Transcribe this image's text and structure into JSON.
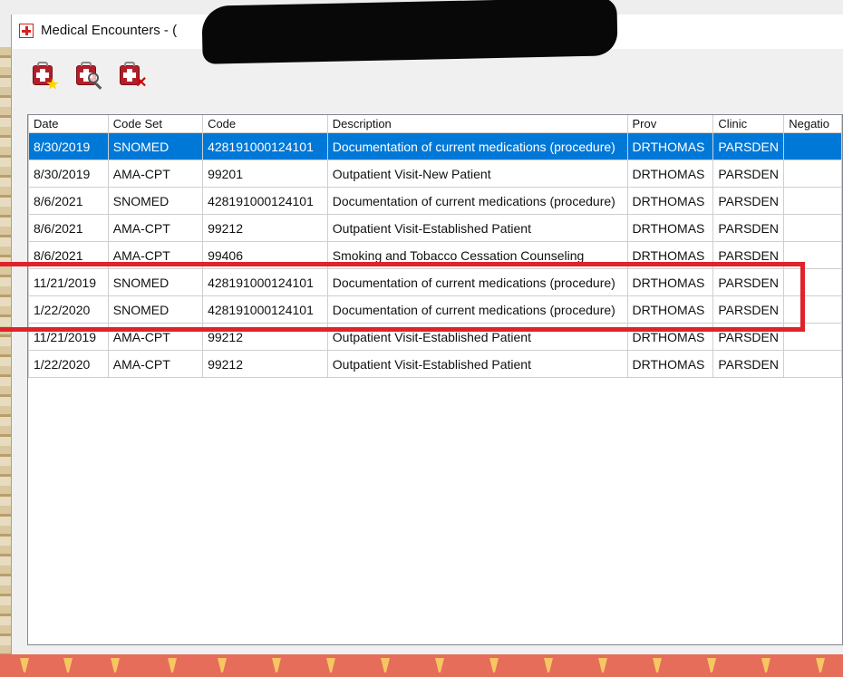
{
  "window": {
    "title": "Medical Encounters - (",
    "title_icon": "medical-kit-icon"
  },
  "toolbar": {
    "buttons": [
      {
        "name": "add-encounter-button",
        "icon": "medical-kit-new-icon"
      },
      {
        "name": "view-encounter-button",
        "icon": "medical-kit-search-icon"
      },
      {
        "name": "delete-encounter-button",
        "icon": "medical-kit-delete-icon"
      }
    ]
  },
  "grid": {
    "columns": [
      "Date",
      "Code Set",
      "Code",
      "Description",
      "Prov",
      "Clinic",
      "Negatio"
    ],
    "rows": [
      {
        "date": "8/30/2019",
        "code_set": "SNOMED",
        "code": "428191000124101",
        "description": "Documentation of current medications (procedure)",
        "prov": "DRTHOMAS",
        "clinic": "PARSDEN",
        "negation": "",
        "selected": true
      },
      {
        "date": "8/30/2019",
        "code_set": "AMA-CPT",
        "code": "99201",
        "description": "Outpatient Visit-New Patient",
        "prov": "DRTHOMAS",
        "clinic": "PARSDEN",
        "negation": ""
      },
      {
        "date": "8/6/2021",
        "code_set": "SNOMED",
        "code": "428191000124101",
        "description": "Documentation of current medications (procedure)",
        "prov": "DRTHOMAS",
        "clinic": "PARSDEN",
        "negation": ""
      },
      {
        "date": "8/6/2021",
        "code_set": "AMA-CPT",
        "code": "99212",
        "description": "Outpatient Visit-Established Patient",
        "prov": "DRTHOMAS",
        "clinic": "PARSDEN",
        "negation": ""
      },
      {
        "date": "8/6/2021",
        "code_set": "AMA-CPT",
        "code": "99406",
        "description": "Smoking and Tobacco Cessation Counseling",
        "prov": "DRTHOMAS",
        "clinic": "PARSDEN",
        "negation": ""
      },
      {
        "date": "11/21/2019",
        "code_set": "SNOMED",
        "code": "428191000124101",
        "description": "Documentation of current medications (procedure)",
        "prov": "DRTHOMAS",
        "clinic": "PARSDEN",
        "negation": ""
      },
      {
        "date": "1/22/2020",
        "code_set": "SNOMED",
        "code": "428191000124101",
        "description": "Documentation of current medications (procedure)",
        "prov": "DRTHOMAS",
        "clinic": "PARSDEN",
        "negation": ""
      },
      {
        "date": "11/21/2019",
        "code_set": "AMA-CPT",
        "code": "99212",
        "description": "Outpatient Visit-Established Patient",
        "prov": "DRTHOMAS",
        "clinic": "PARSDEN",
        "negation": ""
      },
      {
        "date": "1/22/2020",
        "code_set": "AMA-CPT",
        "code": "99212",
        "description": "Outpatient Visit-Established Patient",
        "prov": "DRTHOMAS",
        "clinic": "PARSDEN",
        "negation": ""
      }
    ]
  },
  "colors": {
    "selection": "#0078d7",
    "annotation": "#e0222a",
    "redaction": "#080808"
  }
}
